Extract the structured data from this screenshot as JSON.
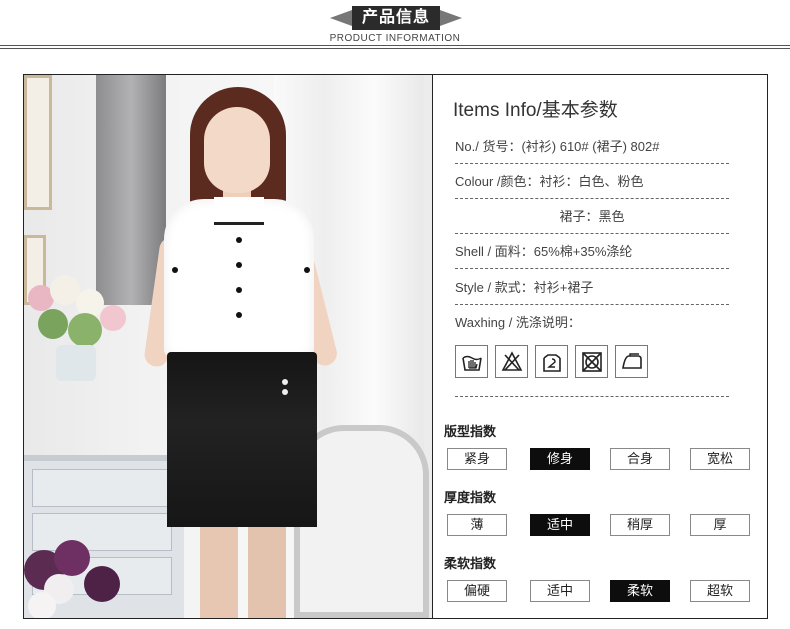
{
  "header": {
    "title": "产品信息",
    "subtitle": "PRODUCT INFORMATION"
  },
  "info": {
    "title": "Items Info/基本参数",
    "rows": [
      "No./ 货号：(衬衫) 610#  (裙子) 802#",
      "Colour /颜色：衬衫：白色、粉色",
      "裙子：黑色",
      "Shell / 面料：65%棉+35%涤纶",
      "Style / 款式：衬衫+裙子",
      "Waxhing / 洗涤说明："
    ],
    "care_icons": [
      "hand-wash-icon",
      "do-not-bleach-icon",
      "hang-dry-icon",
      "do-not-tumble-dry-icon",
      "iron-icon"
    ]
  },
  "scales": [
    {
      "title": "版型指数",
      "options": [
        "紧身",
        "修身",
        "合身",
        "宽松"
      ],
      "selected": "修身"
    },
    {
      "title": "厚度指数",
      "options": [
        "薄",
        "适中",
        "稍厚",
        "厚"
      ],
      "selected": "适中"
    },
    {
      "title": "柔软指数",
      "options": [
        "偏硬",
        "适中",
        "柔软",
        "超软"
      ],
      "selected": "柔软"
    }
  ],
  "colors": {
    "accent": "#0d0d0d",
    "banner": "#2b2b2b"
  }
}
